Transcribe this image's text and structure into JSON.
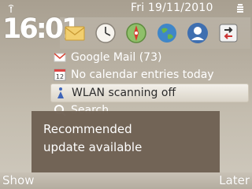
{
  "status_bar": {
    "date_time": "Fri 19/11/2010",
    "signal_icon": "antenna-icon",
    "battery_icon": "battery-icon"
  },
  "home": {
    "clock": "16:01"
  },
  "shortcuts": [
    {
      "name": "messaging-icon"
    },
    {
      "name": "clock-icon"
    },
    {
      "name": "compass-icon"
    },
    {
      "name": "globe-icon"
    },
    {
      "name": "contacts-icon"
    },
    {
      "name": "sync-icon"
    }
  ],
  "notifications": [
    {
      "label": "Google Mail (73)",
      "icon": "gmail-icon"
    },
    {
      "label": "No calendar entries today",
      "icon": "calendar-icon",
      "icon_text": "12"
    },
    {
      "label": "WLAN scanning off",
      "icon": "wlan-icon"
    },
    {
      "label": "Search",
      "icon": "search-icon"
    }
  ],
  "popup": {
    "text": "Recommended\nupdate available"
  },
  "softkeys": {
    "left": "Show",
    "right": "Later"
  }
}
